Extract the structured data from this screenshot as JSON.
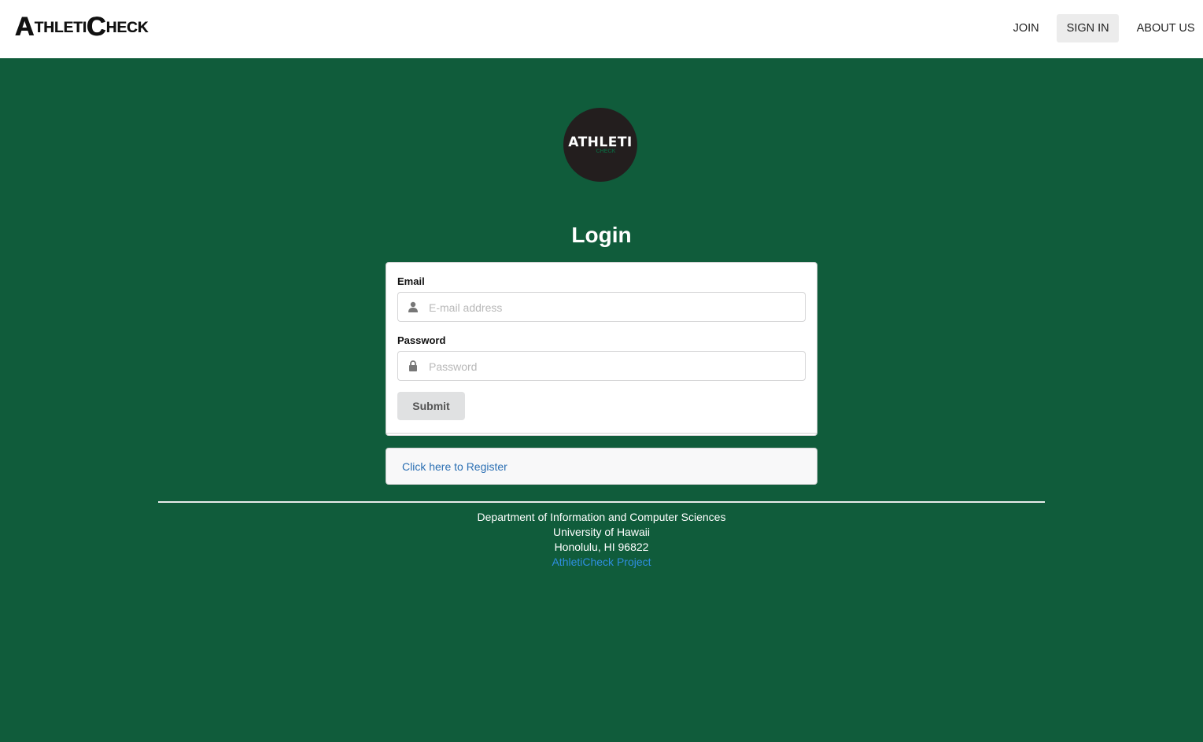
{
  "brand": {
    "first_big": "A",
    "first_small": "THLETI",
    "second_big": "C",
    "second_small": "HECK"
  },
  "nav": {
    "items": [
      {
        "label": "JOIN"
      },
      {
        "label": "SIGN IN"
      },
      {
        "label": "ABOUT US"
      }
    ],
    "active": "SIGN IN"
  },
  "logo": {
    "word": "ATHLETI",
    "sub": "CHECK"
  },
  "login": {
    "title": "Login",
    "email_label": "Email",
    "email_placeholder": "E-mail address",
    "password_label": "Password",
    "password_placeholder": "Password",
    "submit_label": "Submit"
  },
  "register": {
    "link_text": "Click here to Register"
  },
  "footer": {
    "line1": "Department of Information and Computer Sciences",
    "line2": "University of Hawaii",
    "line3": "Honolulu, HI 96822",
    "project_link": "AthletiCheck Project"
  },
  "colors": {
    "background": "#105c3b",
    "link": "#2b6fb3"
  },
  "icons": [
    "user-icon",
    "lock-icon"
  ]
}
